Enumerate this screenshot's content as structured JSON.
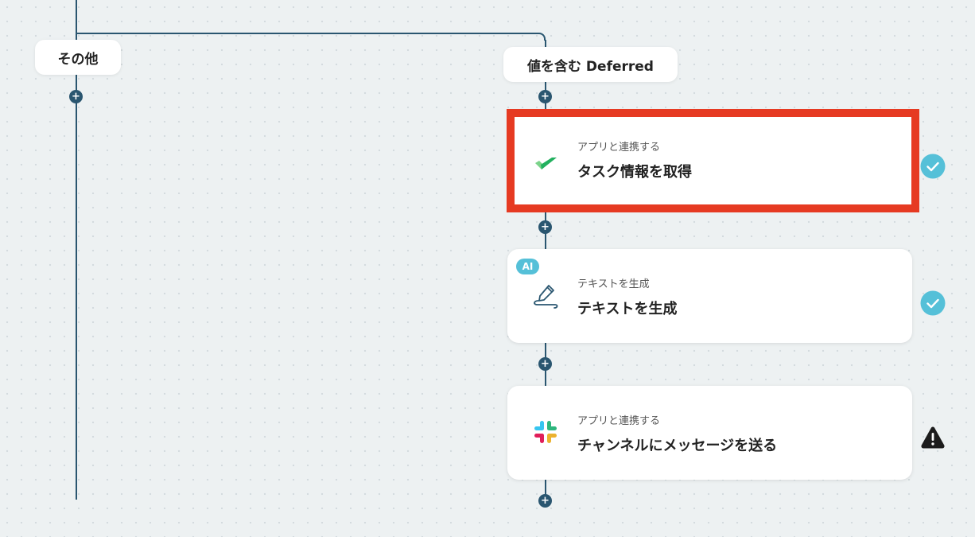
{
  "branches": {
    "other_label": "その他",
    "contains_label": "値を含む Deferred"
  },
  "plus_glyph": "+",
  "steps": [
    {
      "subtitle": "アプリと連携する",
      "title": "タスク情報を取得",
      "icon": "green-check-app-icon",
      "status": "completed",
      "selected": true
    },
    {
      "badge": "AI",
      "subtitle": "テキストを生成",
      "title": "テキストを生成",
      "icon": "pen-signature-icon",
      "status": "completed",
      "selected": false
    },
    {
      "subtitle": "アプリと連携する",
      "title": "チャンネルにメッセージを送る",
      "icon": "slack-icon",
      "status": "warning",
      "selected": false
    }
  ],
  "colors": {
    "connector": "#2a5670",
    "selection": "#e63a22",
    "check": "#55c0d8",
    "warning": "#1c1c1c",
    "background": "#edf1f2"
  }
}
